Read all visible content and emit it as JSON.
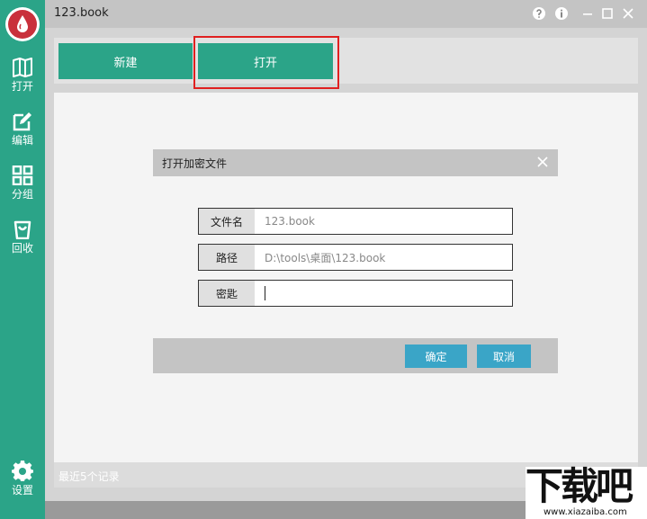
{
  "window": {
    "title": "123.book"
  },
  "sidebar": {
    "items": [
      {
        "label": "打开",
        "icon": "book-icon"
      },
      {
        "label": "编辑",
        "icon": "edit-icon"
      },
      {
        "label": "分组",
        "icon": "grid-icon"
      },
      {
        "label": "回收",
        "icon": "trash-icon"
      }
    ],
    "settings": {
      "label": "设置",
      "icon": "gear-icon"
    }
  },
  "tabs": {
    "new_label": "新建",
    "open_label": "打开"
  },
  "dialog": {
    "title": "打开加密文件",
    "fields": [
      {
        "label": "文件名",
        "value": "123.book"
      },
      {
        "label": "路径",
        "value": "D:\\tools\\桌面\\123.book"
      },
      {
        "label": "密匙",
        "value": ""
      }
    ],
    "confirm_label": "确定",
    "cancel_label": "取消"
  },
  "status": {
    "text": "最近5个记录"
  },
  "watermark": {
    "main": "下载吧",
    "sub": "www.xiazaiba.com"
  },
  "colors": {
    "accent": "#2ba488",
    "button_blue": "#3aa5c7",
    "highlight": "#e02020",
    "logo_red": "#c9303b"
  }
}
